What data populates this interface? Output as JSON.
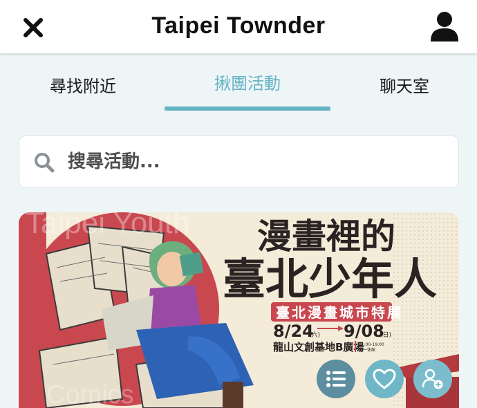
{
  "header": {
    "title": "Taipei Townder",
    "close_icon": "close-icon",
    "profile_icon": "user-icon"
  },
  "tabs": [
    {
      "label": "尋找附近",
      "active": false
    },
    {
      "label": "揪團活動",
      "active": true
    },
    {
      "label": "聊天室",
      "active": false
    }
  ],
  "search": {
    "placeholder": "搜尋活動...",
    "icon": "search-icon"
  },
  "event_card": {
    "banner": {
      "watermark_top": "Taipei Youth",
      "watermark_bottom": "Comics",
      "title_line1": "漫畫裡的",
      "title_line2": "臺北少年人",
      "subtitle": "臺北漫畫城市特展",
      "date_start": "8/24",
      "date_end": "9/08",
      "weekday_start": "(六)",
      "weekday_end": "(日)",
      "venue": "龍山文創基地B廣場",
      "hours": "11:00-19:00",
      "closed_note": "週一休館"
    },
    "actions": [
      {
        "name": "list",
        "icon": "list-icon"
      },
      {
        "name": "favorite",
        "icon": "heart-icon"
      },
      {
        "name": "join",
        "icon": "user-plus-icon"
      }
    ]
  },
  "colors": {
    "accent": "#66b4c3",
    "background": "#eef5f7",
    "banner_red": "#c9474f"
  }
}
